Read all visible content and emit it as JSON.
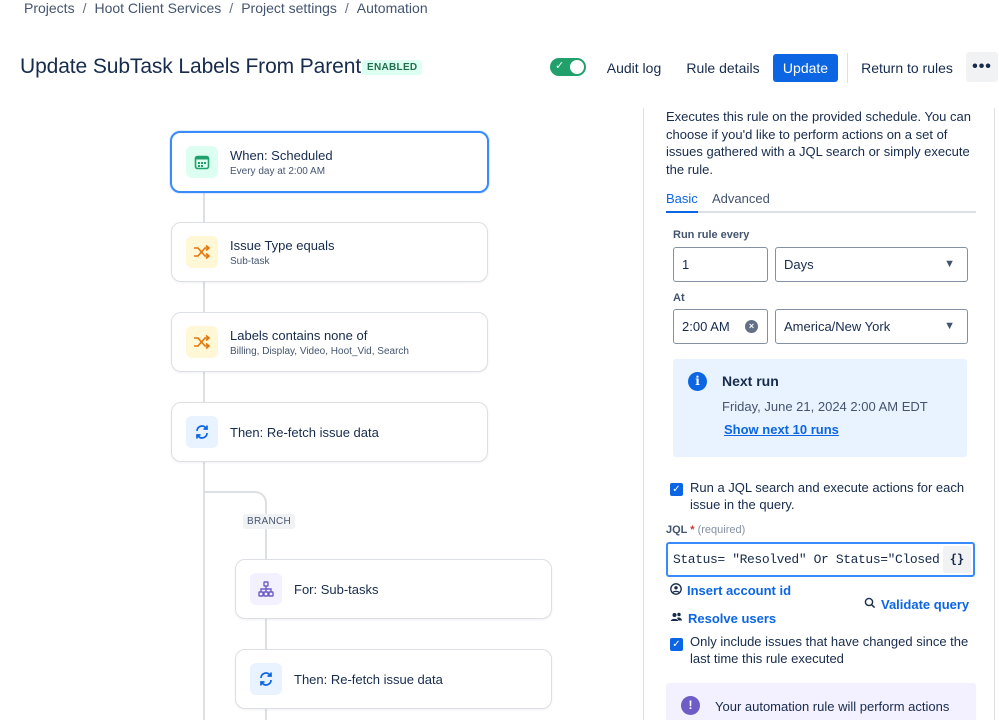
{
  "breadcrumb": [
    "Projects",
    "Hoot Client Services",
    "Project settings",
    "Automation"
  ],
  "breadcrumb_sep": "/",
  "header": {
    "title": "Update SubTask Labels From Parent",
    "status_badge": "ENABLED",
    "toggle_on": true,
    "audit_log": "Audit log",
    "rule_details": "Rule details",
    "update": "Update",
    "return_to_rules": "Return to rules",
    "more": "•••"
  },
  "flow": {
    "trigger": {
      "title": "When: Scheduled",
      "subtitle": "Every day at 2:00 AM",
      "icon": "calendar-icon"
    },
    "condition1": {
      "title": "Issue Type equals",
      "subtitle": "Sub-task",
      "icon": "shuffle-icon"
    },
    "condition2": {
      "title": "Labels contains none of",
      "subtitle": "Billing, Display, Video, Hoot_Vid, Search",
      "icon": "shuffle-icon"
    },
    "action1": {
      "title": "Then: Re-fetch issue data",
      "icon": "refresh-icon"
    },
    "branch_tag": "BRANCH",
    "branch": {
      "title": "For: Sub-tasks",
      "icon": "hierarchy-icon"
    },
    "action2": {
      "title": "Then: Re-fetch issue data",
      "icon": "refresh-icon"
    }
  },
  "panel": {
    "description_lines": [
      "Executes this rule on the provided schedule. You can",
      "choose if you'd like to perform actions on a set of",
      "issues gathered with a JQL search or simply execute",
      "the rule."
    ],
    "tabs": [
      "Basic",
      "Advanced"
    ],
    "active_tab": "Basic",
    "run_rule_every_label": "Run rule every",
    "interval_value": "1",
    "interval_unit": "Days",
    "at_label": "At",
    "time_value": "2:00 AM",
    "timezone": "America/New York",
    "next_run": {
      "title": "Next run",
      "date": "Friday, June 21, 2024 2:00 AM EDT",
      "link": "Show next 10 runs"
    },
    "jql_checkbox": {
      "checked": true,
      "line1": "Run a JQL search and execute actions for each",
      "line2": "issue in the query."
    },
    "jql_label": "JQL",
    "jql_required_star": "*",
    "jql_required": "(required)",
    "jql_value": "Status= \"Resolved\" Or Status=\"Closed\" and updated",
    "braces": "{}",
    "insert_account_id": "Insert account id",
    "validate_query": "Validate query",
    "resolve_users": "Resolve users",
    "changed_checkbox": {
      "checked": true,
      "line1": "Only include issues that have changed since the",
      "line2": "last time this rule executed"
    },
    "warning_text": "Your automation rule will perform actions"
  },
  "colors": {
    "primary": "#0c66e4",
    "success": "#22a06b",
    "selected_border": "#388bff"
  }
}
